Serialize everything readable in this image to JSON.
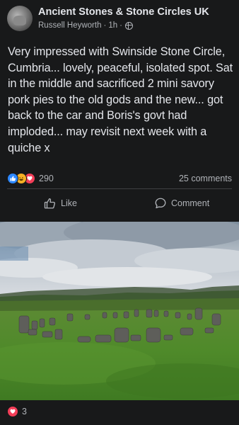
{
  "post": {
    "group_name": "Ancient Stones & Stone Circles UK",
    "author": "Russell Heyworth",
    "time": "1h",
    "separator": "·",
    "privacy_icon": "globe-icon",
    "text": "Very impressed with Swinside Stone Circle, Cumbria... lovely, peaceful, isolated spot. Sat in the middle and sacrificed 2 mini savory pork pies to the old gods and the new... got back to the car and Boris's govt had imploded... may revisit next week with a quiche x",
    "reaction_count": "290",
    "reaction_icons": [
      "like-icon",
      "haha-icon",
      "love-icon"
    ],
    "comments_count": "25 comments",
    "actions": {
      "like_label": "Like",
      "comment_label": "Comment"
    }
  },
  "photo": {
    "subject": "stone circle in a grassy field under a cloudy sky"
  },
  "footer": {
    "reaction_icon": "love-icon",
    "reaction_count": "3"
  },
  "colors": {
    "background": "#18191a",
    "text_primary": "#e4e6eb",
    "text_secondary": "#b0b3b8",
    "like_blue": "#2d88ff",
    "love_red": "#f33e58",
    "haha_yellow": "#f7b125"
  }
}
